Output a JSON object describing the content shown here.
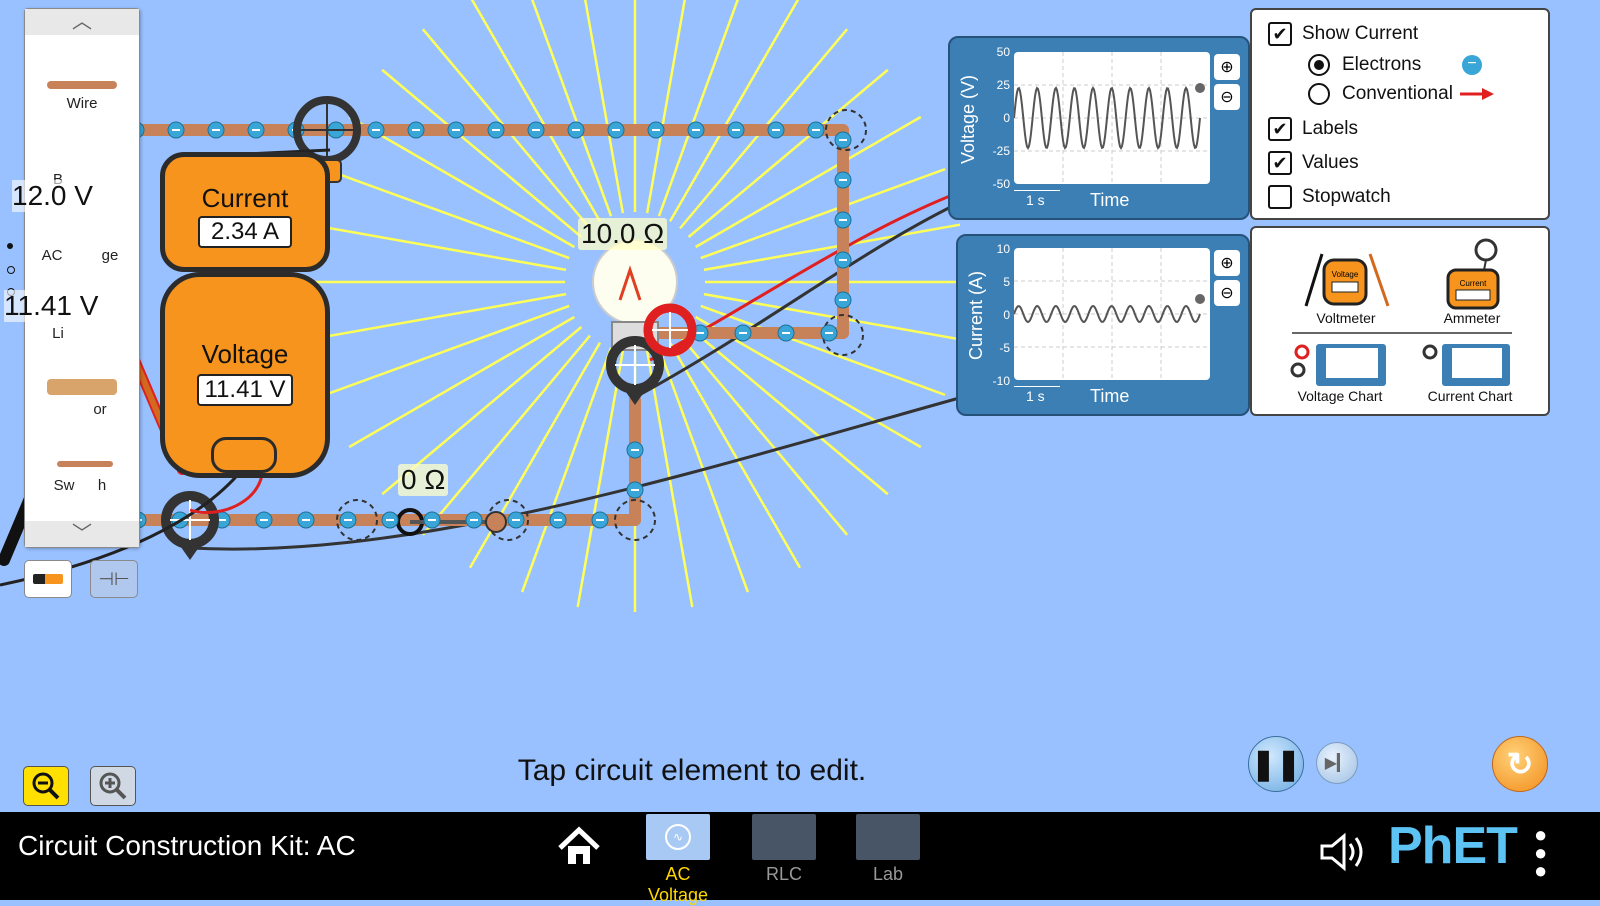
{
  "toolbox": {
    "items": [
      {
        "label": "Wire"
      },
      {
        "label": "B"
      },
      {
        "label": "AC"
      },
      {
        "label": "ge"
      },
      {
        "label": "Li"
      },
      {
        "label": "or"
      },
      {
        "label": "Sw"
      },
      {
        "label": "h"
      }
    ]
  },
  "circuit": {
    "source_voltage": "12.0 V",
    "source_voltage_2": "11.41 V",
    "bulb_resistance": "10.0 Ω",
    "switch_resistance": "0 Ω"
  },
  "ammeter_meter": {
    "title": "Current",
    "reading": "2.34 A"
  },
  "voltmeter_meter": {
    "title": "Voltage",
    "reading": "11.41 V"
  },
  "voltage_chart": {
    "ylabel": "Voltage (V)",
    "ticks": [
      "50",
      "25",
      "0",
      "-25",
      "-50"
    ],
    "xlabel": "Time",
    "scale": "1 s"
  },
  "current_chart": {
    "ylabel": "Current (A)",
    "ticks": [
      "10",
      "5",
      "0",
      "-5",
      "-10"
    ],
    "xlabel": "Time",
    "scale": "1 s"
  },
  "controls": {
    "show_current": {
      "label": "Show Current",
      "checked": true
    },
    "electrons": {
      "label": "Electrons",
      "selected": true
    },
    "conventional": {
      "label": "Conventional",
      "selected": false
    },
    "labels": {
      "label": "Labels",
      "checked": true
    },
    "values": {
      "label": "Values",
      "checked": true
    },
    "stopwatch": {
      "label": "Stopwatch",
      "checked": false
    }
  },
  "tools": {
    "voltmeter": "Voltmeter",
    "ammeter": "Ammeter",
    "voltage_chart": "Voltage Chart",
    "current_chart": "Current Chart",
    "voltmeter_icon_text": "Voltage",
    "ammeter_icon_text": "Current"
  },
  "status": {
    "message": "Tap circuit element to edit."
  },
  "navbar": {
    "title": "Circuit Construction Kit: AC",
    "screens": [
      {
        "label": "AC Voltage",
        "active": true
      },
      {
        "label": "RLC",
        "active": false
      },
      {
        "label": "Lab",
        "active": false
      }
    ],
    "brand": "PhET"
  },
  "colors": {
    "background": "#99c1ff",
    "meter_orange": "#f6941e",
    "chart_blue": "#3b7fb5",
    "active_tab": "#ffd700",
    "electron": "#3aa6d8",
    "wire": "#c8825a"
  }
}
